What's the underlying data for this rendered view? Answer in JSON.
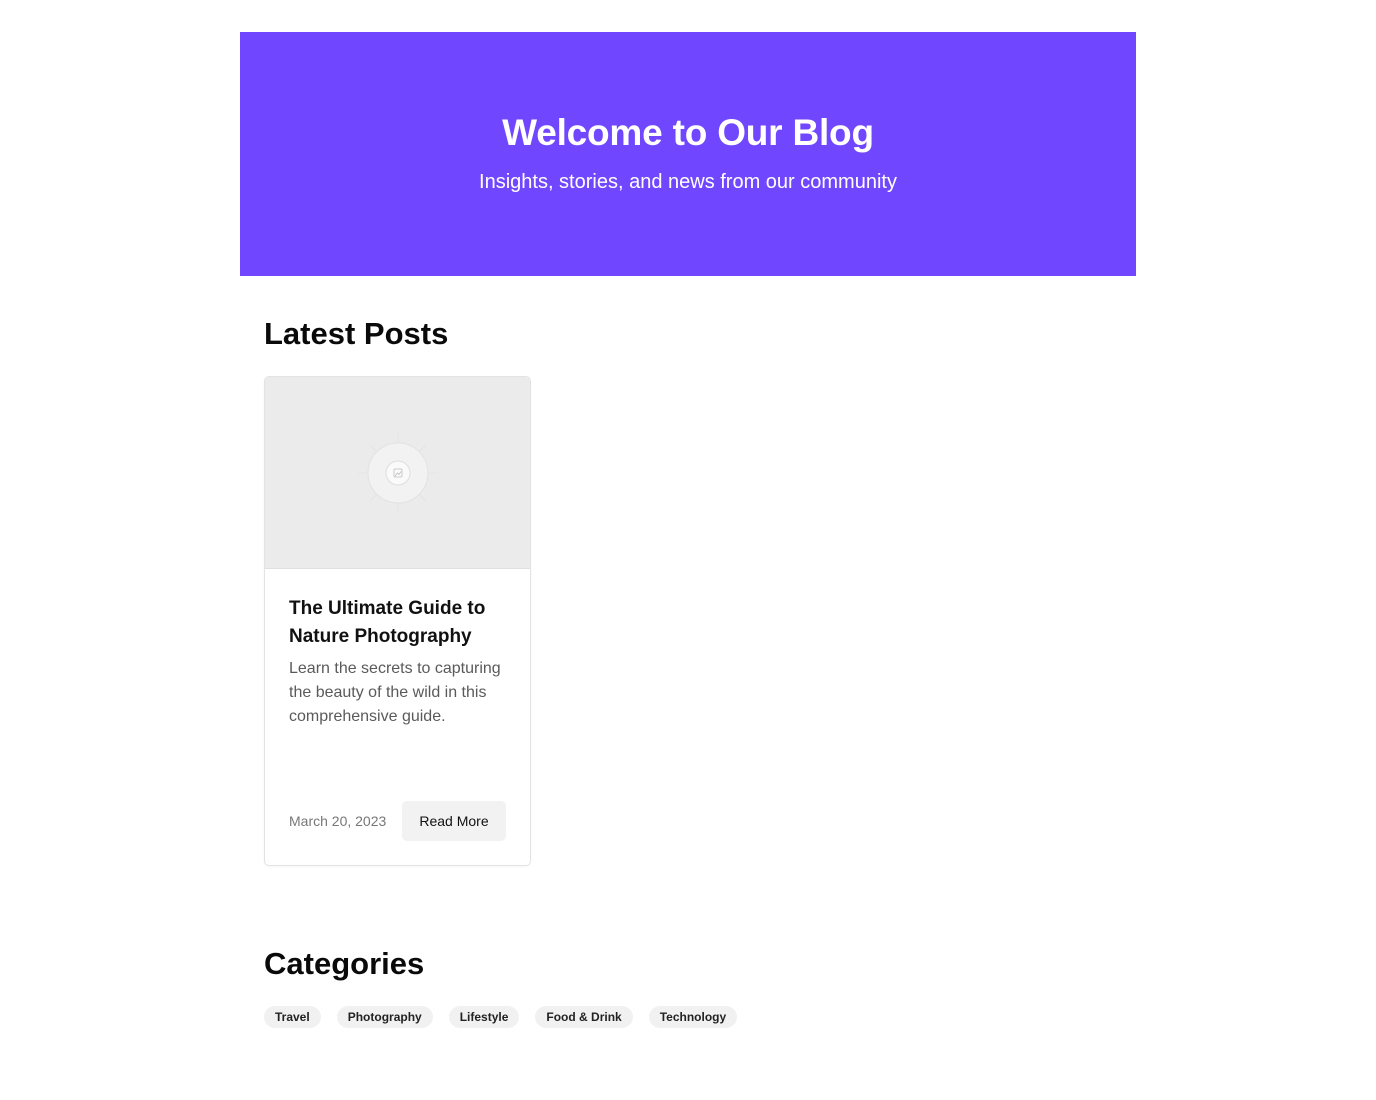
{
  "hero": {
    "title": "Welcome to Our Blog",
    "subtitle": "Insights, stories, and news from our community",
    "background_color": "#7047ff"
  },
  "latest": {
    "heading": "Latest Posts",
    "posts": [
      {
        "image_icon": "image-placeholder-icon",
        "title": "The Ultimate Guide to Nature Photography",
        "excerpt": "Learn the secrets to capturing the beauty of the wild in this comprehensive guide.",
        "date": "March 20, 2023",
        "button_label": "Read More"
      }
    ]
  },
  "categories": {
    "heading": "Categories",
    "items": [
      "Travel",
      "Photography",
      "Lifestyle",
      "Food & Drink",
      "Technology"
    ]
  }
}
